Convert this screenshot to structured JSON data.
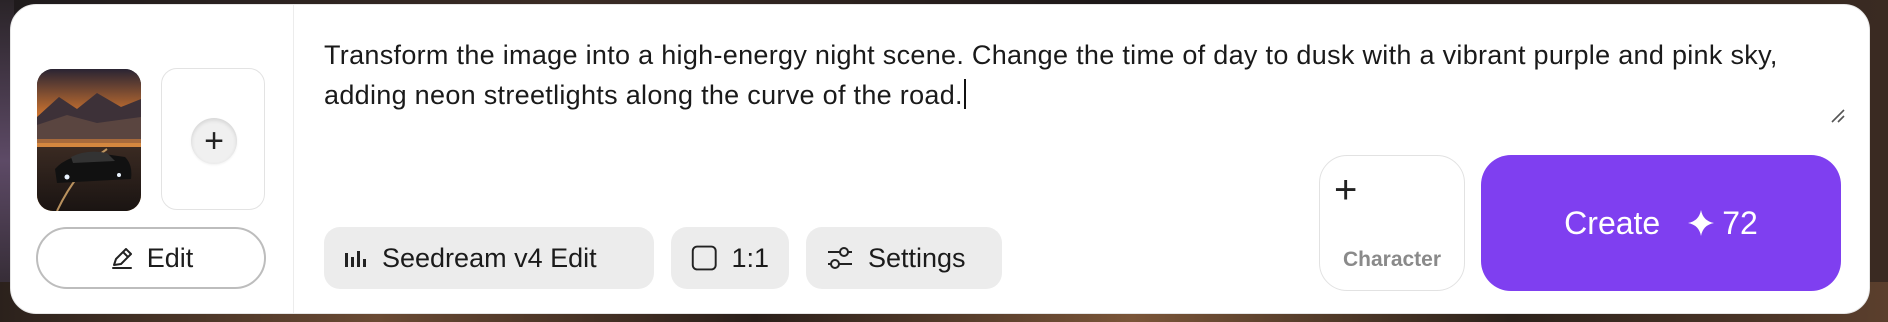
{
  "prompt": {
    "text": "Transform the image into a high-energy night scene. Change the time of day to dusk with a vibrant purple and pink sky, adding neon streetlights along the curve of the road."
  },
  "reference": {
    "edit_label": "Edit",
    "add_icon": "plus-icon",
    "edit_icon": "pencil-icon"
  },
  "toolbar": {
    "model_label": "Seedream v4 Edit",
    "model_icon": "bars-icon",
    "ratio_label": "1:1",
    "ratio_icon": "square-icon",
    "settings_label": "Settings",
    "settings_icon": "sliders-icon"
  },
  "character": {
    "label": "Character",
    "icon": "plus-icon"
  },
  "create": {
    "label": "Create",
    "credits": "72",
    "icon": "sparkle-icon",
    "color": "#7f3ff0"
  }
}
